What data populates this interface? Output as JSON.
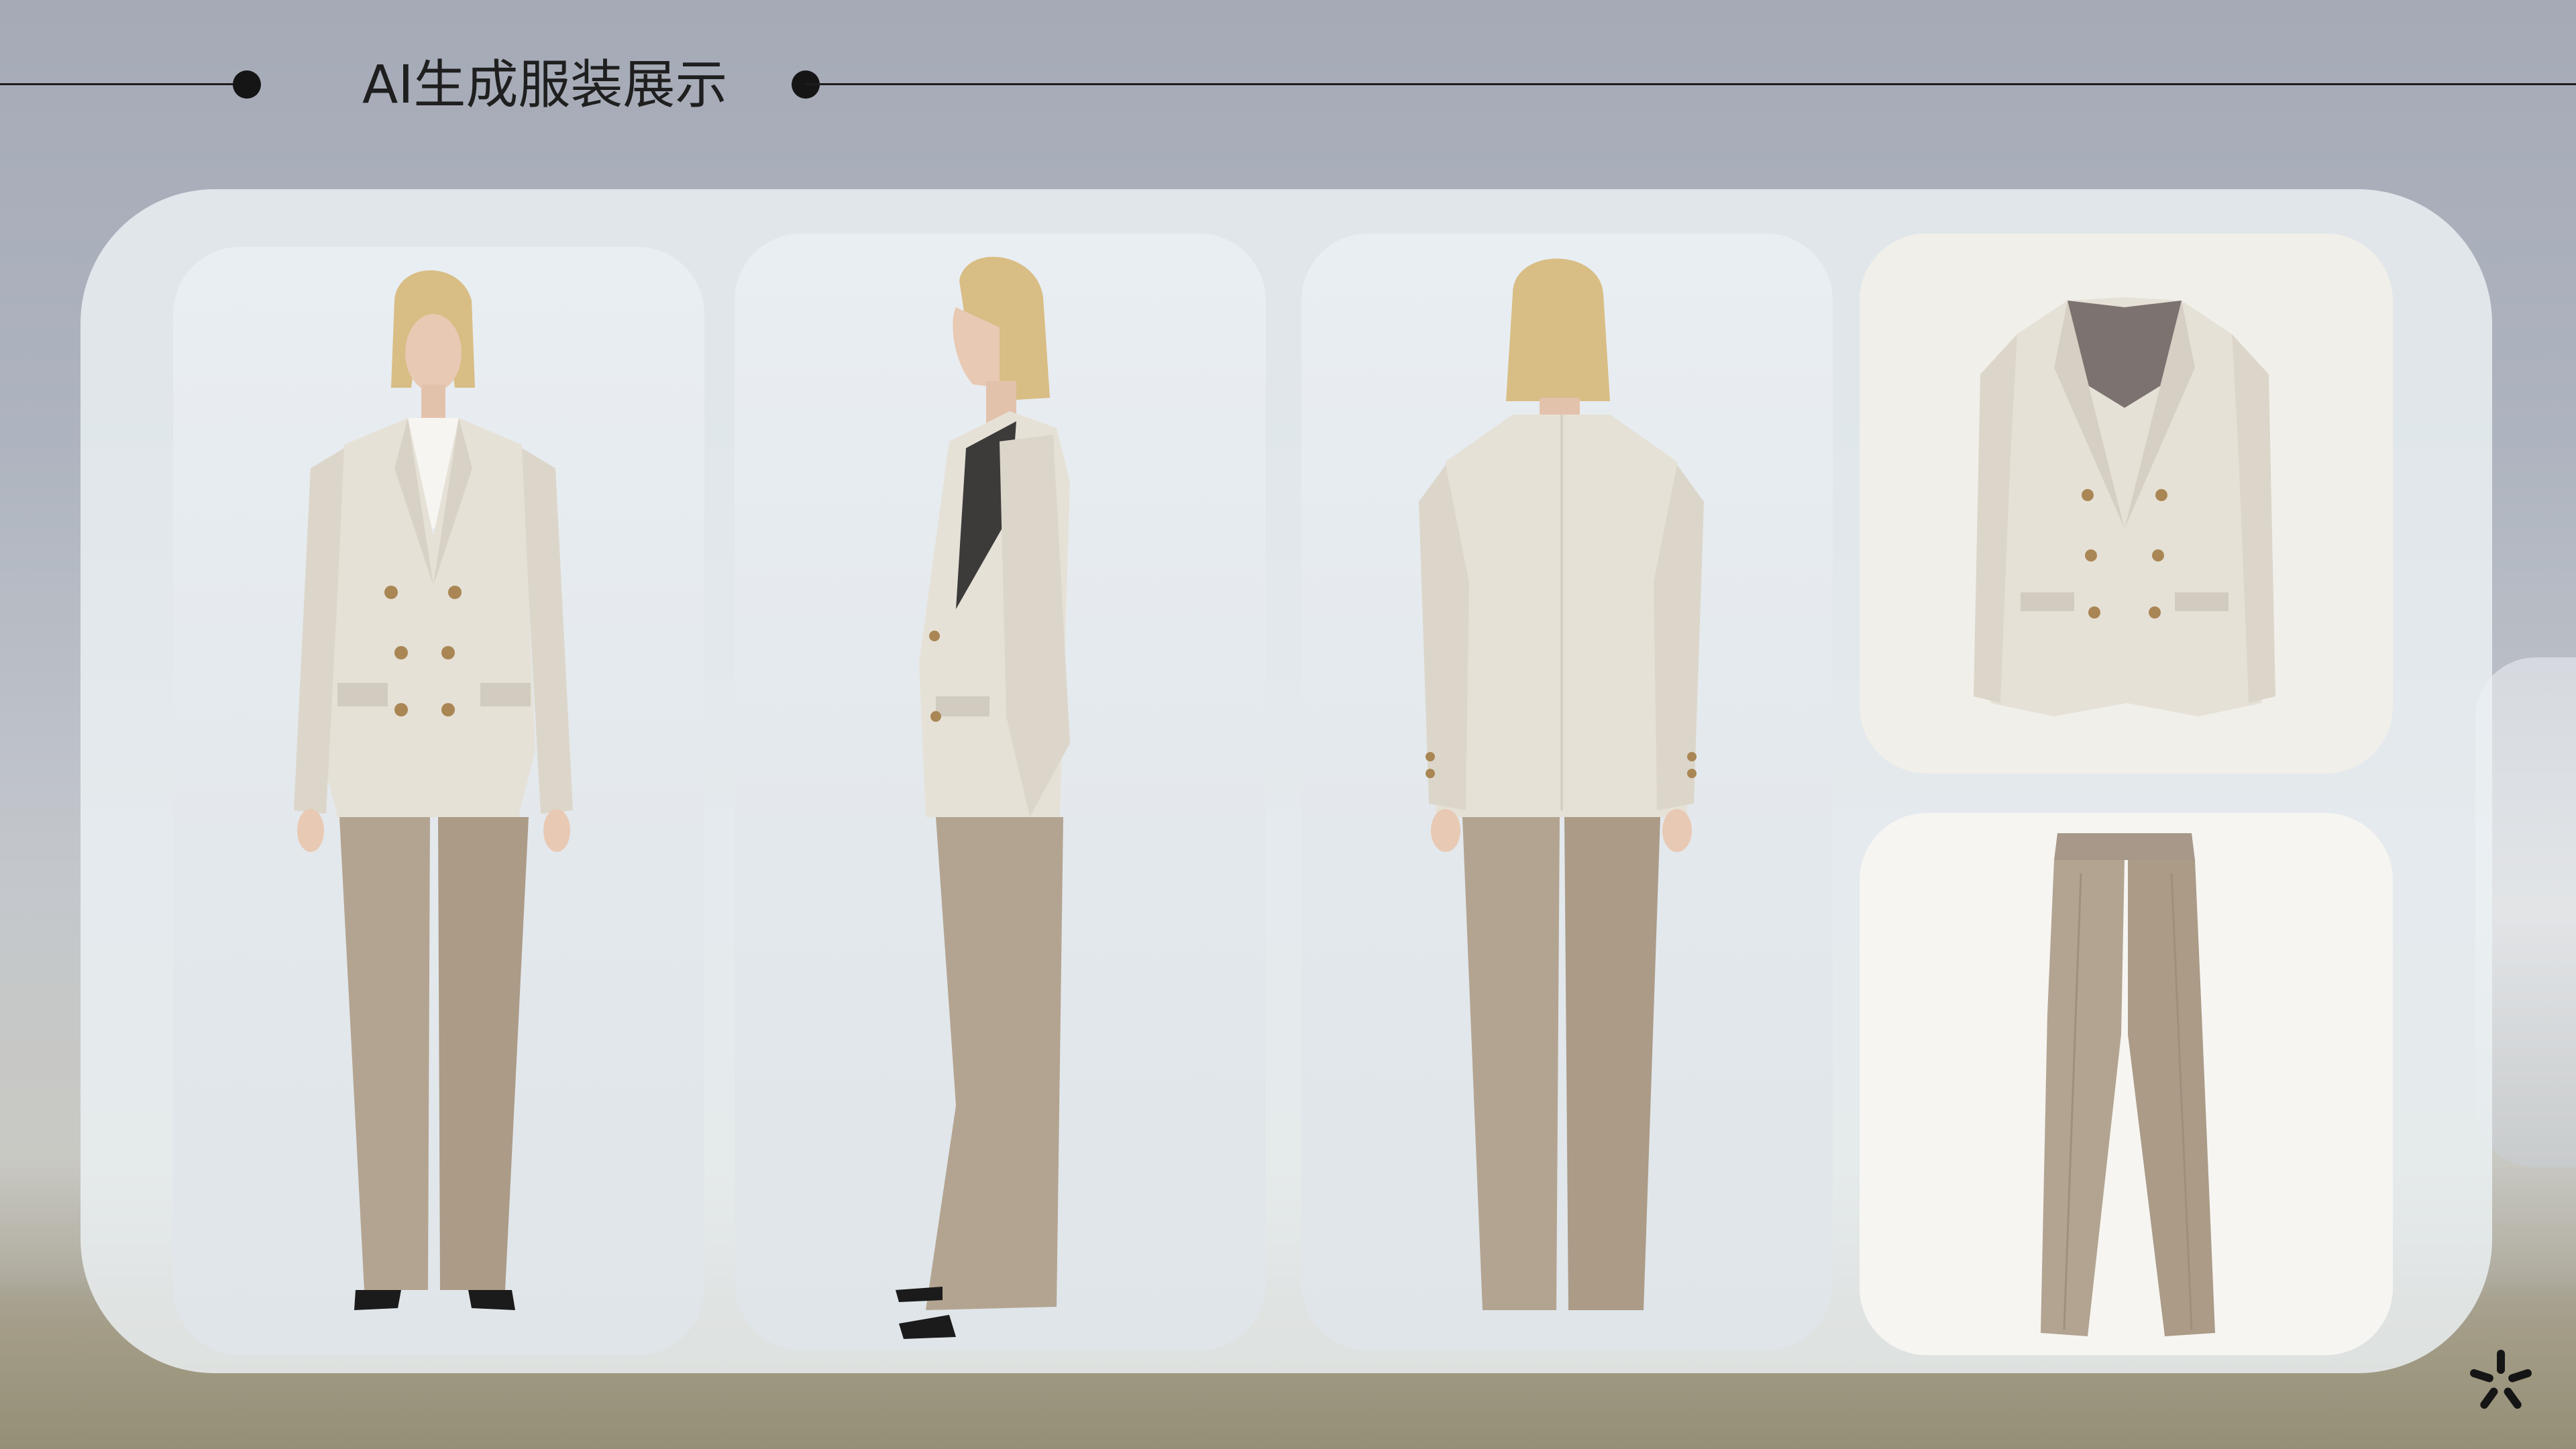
{
  "header": {
    "title": "AI生成服装展示"
  },
  "gallery": {
    "views": [
      {
        "name": "front-view"
      },
      {
        "name": "side-view"
      },
      {
        "name": "back-view"
      },
      {
        "name": "jacket-product"
      },
      {
        "name": "trousers-product"
      }
    ]
  },
  "colors": {
    "background_sky": "#a5aab6",
    "panel": "#ecf1f4",
    "jacket": "#e6e1d7",
    "jacket_shadow": "#d4cec2",
    "buttons": "#a98654",
    "trousers": "#b3a491",
    "trousers_shadow": "#9f8f7b",
    "hair": "#d8bd84",
    "skin": "#e8c9b3",
    "shoes": "#1b1b1b",
    "lining": "#7c7270",
    "accent_line": "#1d1d1d"
  },
  "icons": [
    "decorative-dot-icon",
    "sparkle-logo-icon"
  ]
}
